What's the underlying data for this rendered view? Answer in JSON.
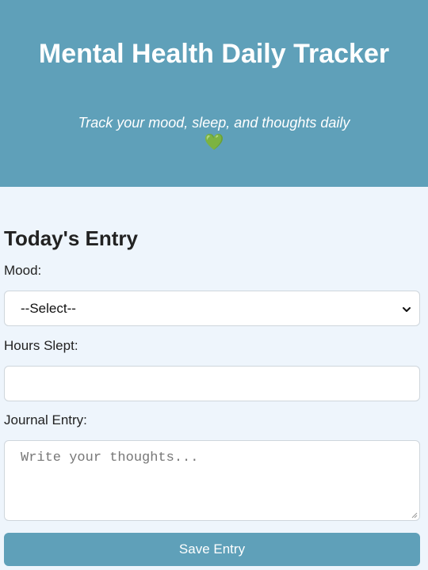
{
  "header": {
    "title": "Mental Health Daily Tracker",
    "subtitle": "Track your mood, sleep, and thoughts daily",
    "heart_icon": "💚"
  },
  "form": {
    "section_title": "Today's Entry",
    "mood_label": "Mood:",
    "mood_selected": "--Select--",
    "hours_label": "Hours Slept:",
    "hours_value": "",
    "journal_label": "Journal Entry:",
    "journal_placeholder": "Write your thoughts...",
    "save_label": "Save Entry"
  },
  "colors": {
    "header_bg": "#5fa0b9",
    "page_bg": "#eef5fc",
    "button_bg": "#5fa0b9",
    "text_white": "#ffffff"
  },
  "icons": {
    "mood_dropdown": "chevron-down-icon",
    "heart": "green-heart-icon",
    "resize": "resize-grip-icon"
  }
}
